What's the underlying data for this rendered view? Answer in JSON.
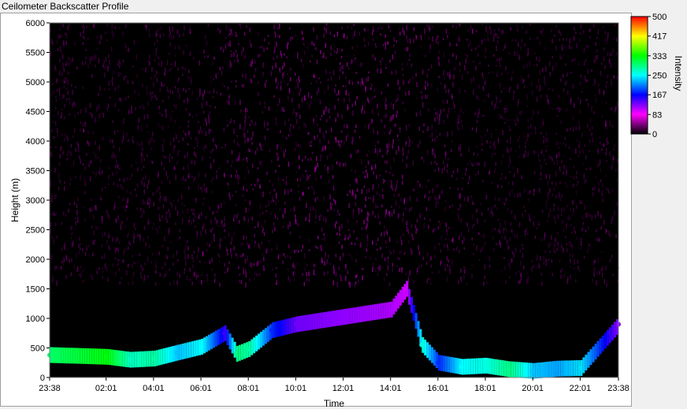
{
  "title": "Ceilometer Backscatter Profile",
  "chart_data": {
    "type": "heatmap",
    "title": "Ceilometer Backscatter Profile",
    "xlabel": "Time",
    "ylabel": "Height (m)",
    "colorbar_label": "Intensity",
    "x_ticks": [
      "23:38",
      "02:01",
      "04:01",
      "06:01",
      "08:01",
      "10:01",
      "12:01",
      "14:01",
      "16:01",
      "18:01",
      "20:01",
      "22:01",
      "23:38"
    ],
    "y_ticks": [
      0,
      500,
      1000,
      1500,
      2000,
      2500,
      3000,
      3500,
      4000,
      4500,
      5000,
      5500,
      6000
    ],
    "ylim": [
      0,
      6000
    ],
    "colorbar_ticks": [
      0,
      83,
      167,
      250,
      333,
      417,
      500
    ],
    "colorbar_range": [
      0,
      500
    ],
    "colorscale": [
      "#000000",
      "#ff00ff",
      "#0000ff",
      "#00ffff",
      "#00ff00",
      "#ffff00",
      "#ff0000"
    ],
    "boundary_layer": [
      {
        "time": "23:38",
        "height_m": 380,
        "intensity": 300
      },
      {
        "time": "02:01",
        "height_m": 350,
        "intensity": 330
      },
      {
        "time": "03:00",
        "height_m": 300,
        "intensity": 270
      },
      {
        "time": "04:01",
        "height_m": 320,
        "intensity": 280
      },
      {
        "time": "05:00",
        "height_m": 420,
        "intensity": 230
      },
      {
        "time": "06:01",
        "height_m": 520,
        "intensity": 250
      },
      {
        "time": "07:00",
        "height_m": 750,
        "intensity": 150
      },
      {
        "time": "07:30",
        "height_m": 400,
        "intensity": 290
      },
      {
        "time": "08:01",
        "height_m": 480,
        "intensity": 280
      },
      {
        "time": "09:00",
        "height_m": 800,
        "intensity": 180
      },
      {
        "time": "10:01",
        "height_m": 900,
        "intensity": 130
      },
      {
        "time": "14:01",
        "height_m": 1150,
        "intensity": 110
      },
      {
        "time": "14:40",
        "height_m": 1500,
        "intensity": 100
      },
      {
        "time": "15:20",
        "height_m": 550,
        "intensity": 260
      },
      {
        "time": "16:01",
        "height_m": 250,
        "intensity": 180
      },
      {
        "time": "17:00",
        "height_m": 180,
        "intensity": 250
      },
      {
        "time": "18:01",
        "height_m": 200,
        "intensity": 260
      },
      {
        "time": "19:00",
        "height_m": 140,
        "intensity": 290
      },
      {
        "time": "20:01",
        "height_m": 110,
        "intensity": 230
      },
      {
        "time": "21:00",
        "height_m": 150,
        "intensity": 220
      },
      {
        "time": "22:01",
        "height_m": 160,
        "intensity": 240
      },
      {
        "time": "23:38",
        "height_m": 900,
        "intensity": 120
      }
    ]
  }
}
